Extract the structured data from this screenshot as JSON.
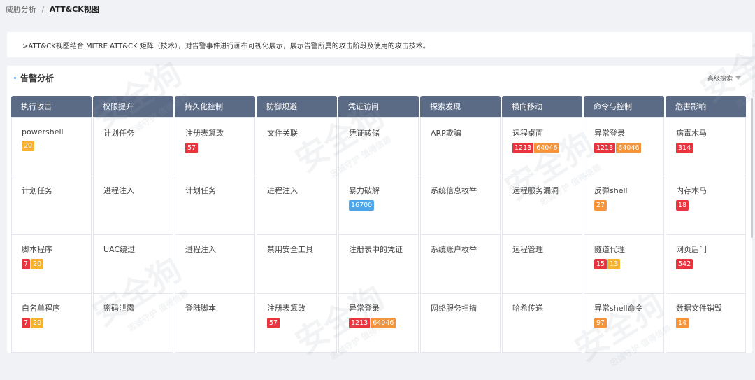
{
  "breadcrumb": {
    "parent": "威胁分析",
    "separator": "/",
    "current": "ATT&CK视图"
  },
  "description": ">ATT&CK视图结合 MITRE ATT&CK 矩阵（技术），对告警事件进行画布可视化展示，展示告警所属的攻击阶段及使用的攻击技术。",
  "panel": {
    "title": "告警分析",
    "advanced_search": "高级搜索"
  },
  "watermark": {
    "text": "安全狗",
    "sub": "忠诚守护 值得信赖"
  },
  "colors": {
    "header": "#5c6b85",
    "red": "#e8343f",
    "orange": "#f5943a",
    "yellow": "#f6b12f",
    "blue": "#4da5ea"
  },
  "columns": [
    {
      "name": "执行攻击",
      "techniques": [
        {
          "name": "powershell",
          "badges": [
            {
              "value": "20",
              "color": "yellow"
            }
          ]
        },
        {
          "name": "计划任务",
          "badges": []
        },
        {
          "name": "脚本程序",
          "badges": [
            {
              "value": "7",
              "color": "red"
            },
            {
              "value": "20",
              "color": "yellow"
            }
          ]
        },
        {
          "name": "白名单程序",
          "badges": [
            {
              "value": "7",
              "color": "red"
            },
            {
              "value": "20",
              "color": "yellow"
            }
          ]
        }
      ]
    },
    {
      "name": "权限提升",
      "techniques": [
        {
          "name": "计划任务",
          "badges": []
        },
        {
          "name": "进程注入",
          "badges": []
        },
        {
          "name": "UAC绕过",
          "badges": []
        },
        {
          "name": "密码泄露",
          "badges": []
        }
      ]
    },
    {
      "name": "持久化控制",
      "techniques": [
        {
          "name": "注册表篡改",
          "badges": [
            {
              "value": "57",
              "color": "red"
            }
          ]
        },
        {
          "name": "计划任务",
          "badges": []
        },
        {
          "name": "进程注入",
          "badges": []
        },
        {
          "name": "登陆脚本",
          "badges": []
        }
      ]
    },
    {
      "name": "防御规避",
      "techniques": [
        {
          "name": "文件关联",
          "badges": []
        },
        {
          "name": "进程注入",
          "badges": []
        },
        {
          "name": "禁用安全工具",
          "badges": []
        },
        {
          "name": "注册表篡改",
          "badges": [
            {
              "value": "57",
              "color": "red"
            }
          ]
        }
      ]
    },
    {
      "name": "凭证访问",
      "techniques": [
        {
          "name": "凭证转储",
          "badges": []
        },
        {
          "name": "暴力破解",
          "badges": [
            {
              "value": "16700",
              "color": "blue"
            }
          ]
        },
        {
          "name": "注册表中的凭证",
          "badges": []
        },
        {
          "name": "异常登录",
          "badges": [
            {
              "value": "1213",
              "color": "red"
            },
            {
              "value": "64046",
              "color": "orange"
            }
          ]
        }
      ]
    },
    {
      "name": "探索发现",
      "techniques": [
        {
          "name": "ARP欺骗",
          "badges": []
        },
        {
          "name": "系统信息枚举",
          "badges": []
        },
        {
          "name": "系统账户枚举",
          "badges": []
        },
        {
          "name": "网络服务扫描",
          "badges": []
        }
      ]
    },
    {
      "name": "横向移动",
      "techniques": [
        {
          "name": "远程桌面",
          "badges": [
            {
              "value": "1213",
              "color": "red"
            },
            {
              "value": "64046",
              "color": "orange"
            }
          ]
        },
        {
          "name": "远程服务漏洞",
          "badges": []
        },
        {
          "name": "远程管理",
          "badges": []
        },
        {
          "name": "哈希传递",
          "badges": []
        }
      ]
    },
    {
      "name": "命令与控制",
      "techniques": [
        {
          "name": "异常登录",
          "badges": [
            {
              "value": "1213",
              "color": "red"
            },
            {
              "value": "64046",
              "color": "orange"
            }
          ]
        },
        {
          "name": "反弹shell",
          "badges": [
            {
              "value": "27",
              "color": "orange"
            }
          ]
        },
        {
          "name": "隧道代理",
          "badges": [
            {
              "value": "15",
              "color": "red"
            },
            {
              "value": "13",
              "color": "yellow"
            }
          ]
        },
        {
          "name": "异常shell命令",
          "badges": [
            {
              "value": "97",
              "color": "orange"
            }
          ]
        }
      ]
    },
    {
      "name": "危害影响",
      "techniques": [
        {
          "name": "病毒木马",
          "badges": [
            {
              "value": "314",
              "color": "red"
            }
          ]
        },
        {
          "name": "内存木马",
          "badges": [
            {
              "value": "18",
              "color": "red"
            }
          ]
        },
        {
          "name": "网页后门",
          "badges": [
            {
              "value": "542",
              "color": "red"
            }
          ]
        },
        {
          "name": "数据文件销毁",
          "badges": [
            {
              "value": "14",
              "color": "orange"
            }
          ]
        }
      ]
    }
  ]
}
